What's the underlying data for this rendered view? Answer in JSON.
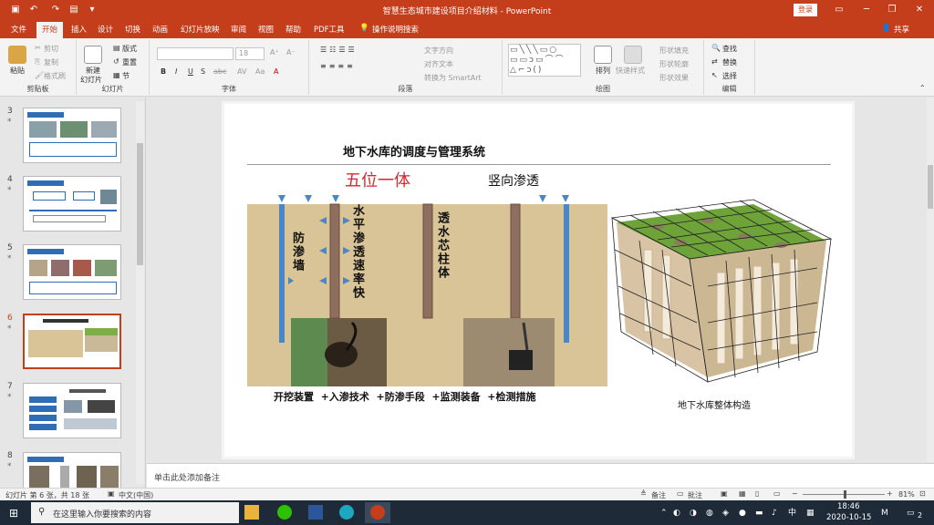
{
  "window": {
    "title": "智慧生态城市建设项目介绍材料 - PowerPoint",
    "login": "登录"
  },
  "quick_access": {
    "save_icon": "save-icon",
    "undo_icon": "undo-icon",
    "redo_icon": "redo-icon",
    "present_icon": "present-icon"
  },
  "tabs": [
    "文件",
    "开始",
    "插入",
    "设计",
    "切换",
    "动画",
    "幻灯片放映",
    "审阅",
    "视图",
    "帮助",
    "PDF工具"
  ],
  "active_tab": "开始",
  "tell_me": "操作说明搜索",
  "share": "共享",
  "ribbon": {
    "clipboard": {
      "label": "剪贴板",
      "paste": "粘贴",
      "cut": "剪切",
      "copy": "复制",
      "format_painter": "格式刷"
    },
    "slides": {
      "label": "幻灯片",
      "new_slide": "新建",
      "new_slide2": "幻灯片",
      "layout": "版式",
      "reset": "重置",
      "section": "节"
    },
    "font": {
      "label": "字体",
      "size": "18",
      "bold": "B",
      "italic": "I",
      "underline": "U",
      "shadow": "S",
      "strike": "abc"
    },
    "paragraph": {
      "label": "段落",
      "text_direction": "文字方向",
      "align_text": "对齐文本",
      "smartart": "转换为 SmartArt"
    },
    "drawing": {
      "label": "绘图",
      "arrange": "排列",
      "quick_styles": "快速样式",
      "fill": "形状填充",
      "outline": "形状轮廓",
      "effects": "形状效果"
    },
    "editing": {
      "label": "编辑",
      "find": "查找",
      "replace": "替换",
      "select": "选择"
    }
  },
  "slides_panel": {
    "items": [
      {
        "num": "3",
        "star": "*"
      },
      {
        "num": "4",
        "star": "*"
      },
      {
        "num": "5",
        "star": "*"
      },
      {
        "num": "6",
        "star": "*"
      },
      {
        "num": "7",
        "star": "*"
      },
      {
        "num": "8",
        "star": "*"
      }
    ],
    "selected": "6"
  },
  "slide": {
    "title": "地下水库的调度与管理系统",
    "heading_red": "五位一体",
    "heading_vertical": "竖向渗透",
    "wall_label": "防渗墙",
    "horizontal_label": "水平渗透速率快",
    "column_label": "透水芯柱体",
    "bottom_label": "开挖装置  +入渗技术  +防渗手段  +监测装备  +检测措施",
    "structure_label": "地下水库整体构造",
    "accent_red": "#d9262c",
    "pipe_blue": "#4a86c5",
    "soil": "#d9c497"
  },
  "notes_placeholder": "单击此处添加备注",
  "status": {
    "slide_info": "幻灯片 第 6 张，共 18 张",
    "language": "中文(中国)",
    "notes": "备注",
    "comments": "批注",
    "zoom": "81%"
  },
  "taskbar": {
    "search": "在这里输入你要搜索的内容",
    "time": "18:46",
    "date": "2020-10-15",
    "ime": "中",
    "notif_count": "2"
  }
}
